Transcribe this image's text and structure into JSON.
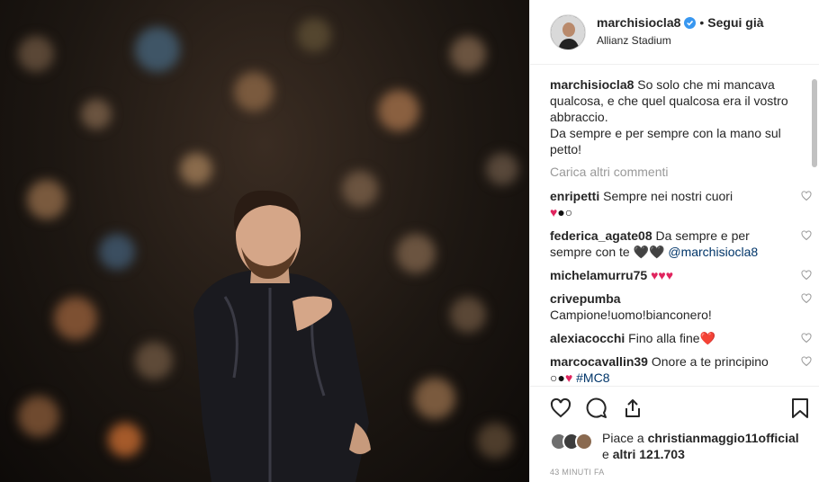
{
  "post": {
    "username": "marchisiocla8",
    "follow_label": "Segui già",
    "location": "Allianz Stadium",
    "caption_user": "marchisiocla8",
    "caption_text": "So solo che mi mancava qualcosa, e che quel qualcosa era il vostro abbraccio.",
    "caption_text2": "Da sempre e per sempre con la mano sul petto!",
    "load_more": "Carica altri commenti"
  },
  "comments": [
    {
      "user": "enripetti",
      "text": "Sempre nei nostri cuori",
      "emoji": "❤️⚫⚪"
    },
    {
      "user": "federica_agate08",
      "text": "Da sempre e per sempre con te 🖤🖤",
      "mention": "@marchisiocla8"
    },
    {
      "user": "michelamurru75",
      "text": "",
      "emoji": "❤️❤️❤️"
    },
    {
      "user": "crivepumba",
      "text": "Campione!uomo!bianconero!"
    },
    {
      "user": "alexiacocchi",
      "text": "Fino alla fine❤️"
    },
    {
      "user": "marcocavallin39",
      "text": "Onore a te principino",
      "emoji": "⚪⚫❤️",
      "mention": "#MC8"
    }
  ],
  "likes": {
    "prefix": "Piace a ",
    "user": "christianmaggio11official",
    "suffix": " e ",
    "count": "altri 121.703"
  },
  "time": "43 MINUTI FA",
  "colors": {
    "verified": "#3897f0",
    "heart": "#e0245e",
    "link": "#003569",
    "muted": "#999999"
  },
  "icons": [
    "heart-icon",
    "comment-icon",
    "share-icon",
    "bookmark-icon",
    "verified-icon"
  ]
}
